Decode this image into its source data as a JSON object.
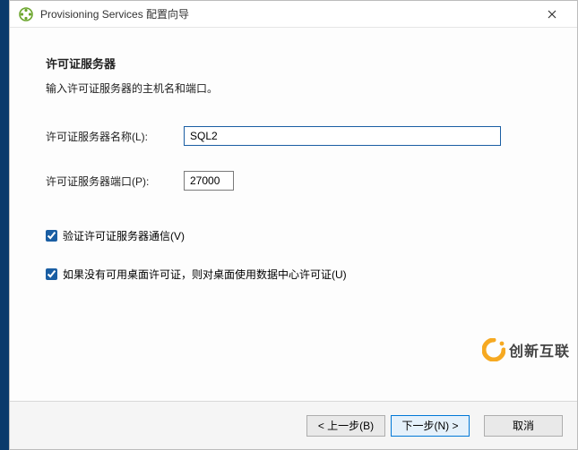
{
  "window": {
    "title": "Provisioning Services 配置向导"
  },
  "page": {
    "heading": "许可证服务器",
    "subheading": "输入许可证服务器的主机名和端口。"
  },
  "form": {
    "name_label": "许可证服务器名称(L):",
    "name_value": "SQL2",
    "port_label": "许可证服务器端口(P):",
    "port_value": "27000"
  },
  "checks": {
    "validate_label": "验证许可证服务器通信(V)",
    "fallback_label": "如果没有可用桌面许可证，则对桌面使用数据中心许可证(U)"
  },
  "buttons": {
    "back": "< 上一步(B)",
    "next": "下一步(N) >",
    "cancel": "取消"
  },
  "watermark": {
    "text": "创新互联"
  }
}
